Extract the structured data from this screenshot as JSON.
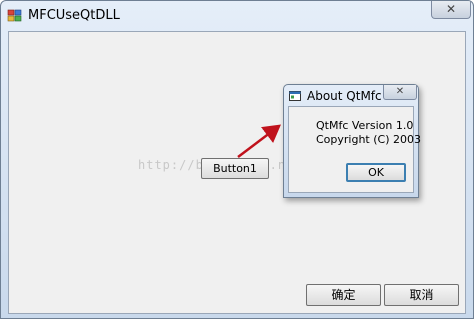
{
  "window": {
    "title": "MFCUseQtDLL",
    "close_glyph": "✕",
    "icon": "mfc-app-icon"
  },
  "main": {
    "button1_label": "Button1",
    "ok_label": "确定",
    "cancel_label": "取消",
    "watermark": "http://blog.csdn.net/"
  },
  "about": {
    "title": "About QtMfc",
    "close_glyph": "✕",
    "line1": "QtMfc Version 1.0",
    "line2": "Copyright (C) 2003",
    "ok_label": "OK",
    "icon": "dialog-icon"
  },
  "annotation": {
    "arrow_color": "#c0121c"
  }
}
